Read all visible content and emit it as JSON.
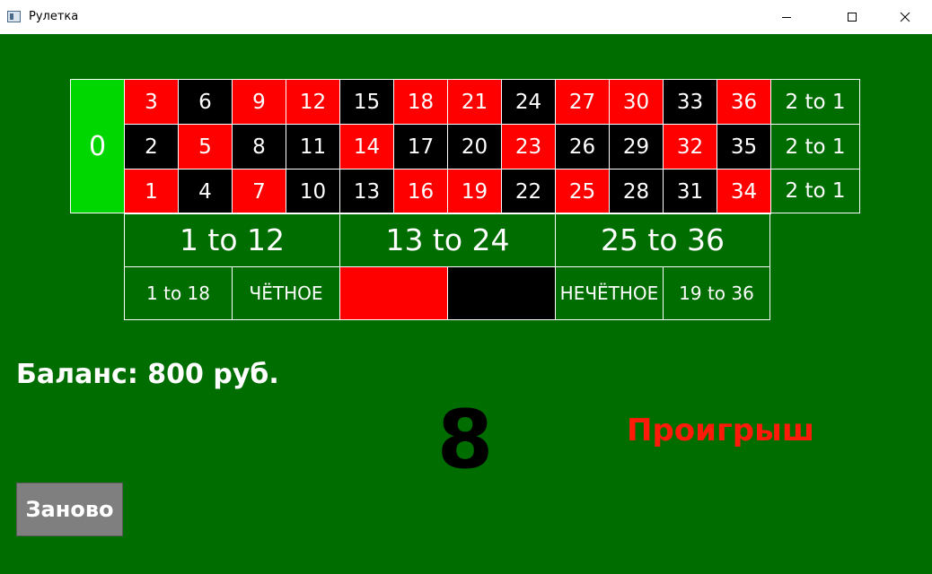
{
  "window": {
    "title": "Рулетка",
    "controls": [
      "minimize-icon",
      "maximize-icon",
      "close-icon"
    ]
  },
  "board": {
    "zero": "0",
    "rows": [
      [
        {
          "n": "3",
          "c": "red"
        },
        {
          "n": "6",
          "c": "black"
        },
        {
          "n": "9",
          "c": "red"
        },
        {
          "n": "12",
          "c": "red"
        },
        {
          "n": "15",
          "c": "black"
        },
        {
          "n": "18",
          "c": "red"
        },
        {
          "n": "21",
          "c": "red"
        },
        {
          "n": "24",
          "c": "black"
        },
        {
          "n": "27",
          "c": "red"
        },
        {
          "n": "30",
          "c": "red"
        },
        {
          "n": "33",
          "c": "black"
        },
        {
          "n": "36",
          "c": "red"
        }
      ],
      [
        {
          "n": "2",
          "c": "black"
        },
        {
          "n": "5",
          "c": "red"
        },
        {
          "n": "8",
          "c": "black"
        },
        {
          "n": "11",
          "c": "black"
        },
        {
          "n": "14",
          "c": "red"
        },
        {
          "n": "17",
          "c": "black"
        },
        {
          "n": "20",
          "c": "black"
        },
        {
          "n": "23",
          "c": "red"
        },
        {
          "n": "26",
          "c": "black"
        },
        {
          "n": "29",
          "c": "black"
        },
        {
          "n": "32",
          "c": "red"
        },
        {
          "n": "35",
          "c": "black"
        }
      ],
      [
        {
          "n": "1",
          "c": "red"
        },
        {
          "n": "4",
          "c": "black"
        },
        {
          "n": "7",
          "c": "red"
        },
        {
          "n": "10",
          "c": "black"
        },
        {
          "n": "13",
          "c": "black"
        },
        {
          "n": "16",
          "c": "red"
        },
        {
          "n": "19",
          "c": "red"
        },
        {
          "n": "22",
          "c": "black"
        },
        {
          "n": "25",
          "c": "red"
        },
        {
          "n": "28",
          "c": "black"
        },
        {
          "n": "31",
          "c": "black"
        },
        {
          "n": "34",
          "c": "red"
        }
      ]
    ],
    "column_bets": [
      "2 to 1",
      "2 to 1",
      "2 to 1"
    ],
    "dozens": [
      "1 to 12",
      "13 to 24",
      "25 to 36"
    ],
    "outside": {
      "low": "1 to 18",
      "even": "ЧЁТНОЕ",
      "red_color": "#ff0000",
      "black_color": "#000000",
      "odd": "НЕЧЁТНОЕ",
      "high": "19 to 36"
    },
    "colors": {
      "felt": "#006d00",
      "red": "#ff0000",
      "black": "#000000",
      "zero": "#00d700"
    }
  },
  "status": {
    "balance": "Баланс: 800 руб.",
    "result_number": "8",
    "result_message": "Проигрыш",
    "result_message_color": "#ff1a0a"
  },
  "actions": {
    "restart_label": "Заново"
  }
}
